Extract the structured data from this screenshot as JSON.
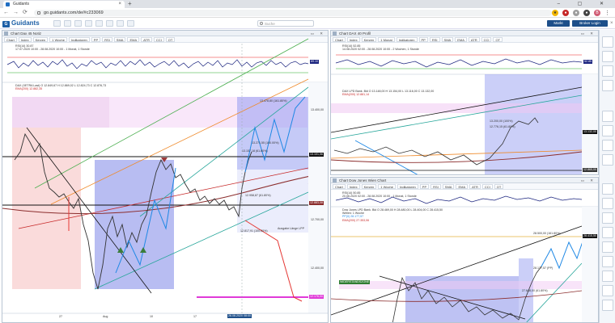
{
  "browser": {
    "tab_title": "Guidants",
    "url": "go.guidants.com/de/#c233069",
    "nav": {
      "back": "←",
      "forward": "→",
      "reload": "⟳"
    },
    "window_controls": "– ▢ ✕",
    "profile_initial": "B"
  },
  "app": {
    "logo_text": "Guidants",
    "search_placeholder": "Suche",
    "market_button": "Markt",
    "broker_button": "Broker Login"
  },
  "panels": {
    "left": {
      "title": "Chart Dax 45 Notiz",
      "toolbar": [
        "Chart",
        "Index",
        "Kerzen",
        "1 Woche",
        "Indikatoren",
        "PP",
        "RSI",
        "SMA",
        "EMA",
        "ATR",
        "CCI",
        "OT"
      ],
      "rsi_info": [
        "RSI(14) 30.87",
        "17.07.2020 10:00 - 28.08.2020 10:00 - 1 Monat, 1 Stunde"
      ],
      "rsi_label": "69.10",
      "main_info": [
        "DAX (XETRA Last) O 12.849,67  H 12.869,02  L 12.824,73  C 12.876,73",
        "EMA(200) 12.882,35"
      ],
      "price_labels": [
        "13.400,00",
        "13.101,06",
        "12.883,08",
        "12.700,00",
        "12.400,00",
        "12.176,00"
      ],
      "annotations": [
        "13.478,80 (161.80%)",
        "13.271,55 (100.00%)",
        "13.157,18 (61.80%)",
        "12.958,87 (61.80%)",
        "12.817,91 (100.00%)",
        "Ausgabe Länge LPP"
      ],
      "date_axis": [
        "27",
        "Aug",
        "10",
        "17",
        "24"
      ],
      "cursor_date": "26.08.2020 08:00"
    },
    "right_top": {
      "title": "Chart DAX 40 Profil",
      "toolbar": [
        "Chart",
        "Index",
        "Kerzen",
        "1 Monat",
        "Indikatoren",
        "PP",
        "RSI",
        "SMA",
        "EMA",
        "ATR",
        "CCI",
        "OT"
      ],
      "rsi_info": [
        "RSI(14) 52.85",
        "14.08.2020 02:00 - 28.08.2020 10:00 - 2 Wochen, 1 Stunde"
      ],
      "rsi_label": "52.85",
      "main_info": [
        "DAX LPD Bank. Bid  O 13.148,00  H 13.154,00  L 13.116,00  C 13.132,00",
        "EMA(200) 12.881,14"
      ],
      "price_labels": [
        "13.132,00",
        "12.865,00"
      ],
      "annotations": [
        "13.200,00 (100%)",
        "12.776,15 (61.80%)"
      ]
    },
    "right_bottom": {
      "title": "Chart Dow Jones Wien Chart",
      "toolbar": [
        "Chart",
        "Index",
        "Kerzen",
        "1 Woche",
        "Indikatoren",
        "PP",
        "RSI",
        "SMA",
        "EMA",
        "ATR",
        "CCI",
        "OT"
      ],
      "rsi_info": [
        "RSI(14) 50.85",
        "20.06.2020 02:00 - 28.08.2020 10:00 - 1 Monat, 1 Stunde"
      ],
      "main_info": [
        "Dow Jones LPD Bank. Bid  O 28.469,00  H 28.480,00  L 28.404,00  C 28.415,50",
        "Wellen: 1 Woche",
        "PP(0) 28.177,57",
        "EMA(200) 27.353,06"
      ],
      "price_labels": [
        "28.415,50"
      ],
      "annotations": [
        "28.500,00 (161.80%)",
        "28.177,57 (PP)",
        "27.648,00 (61.80%)",
        "WIDERSTANDSZONE"
      ]
    }
  }
}
